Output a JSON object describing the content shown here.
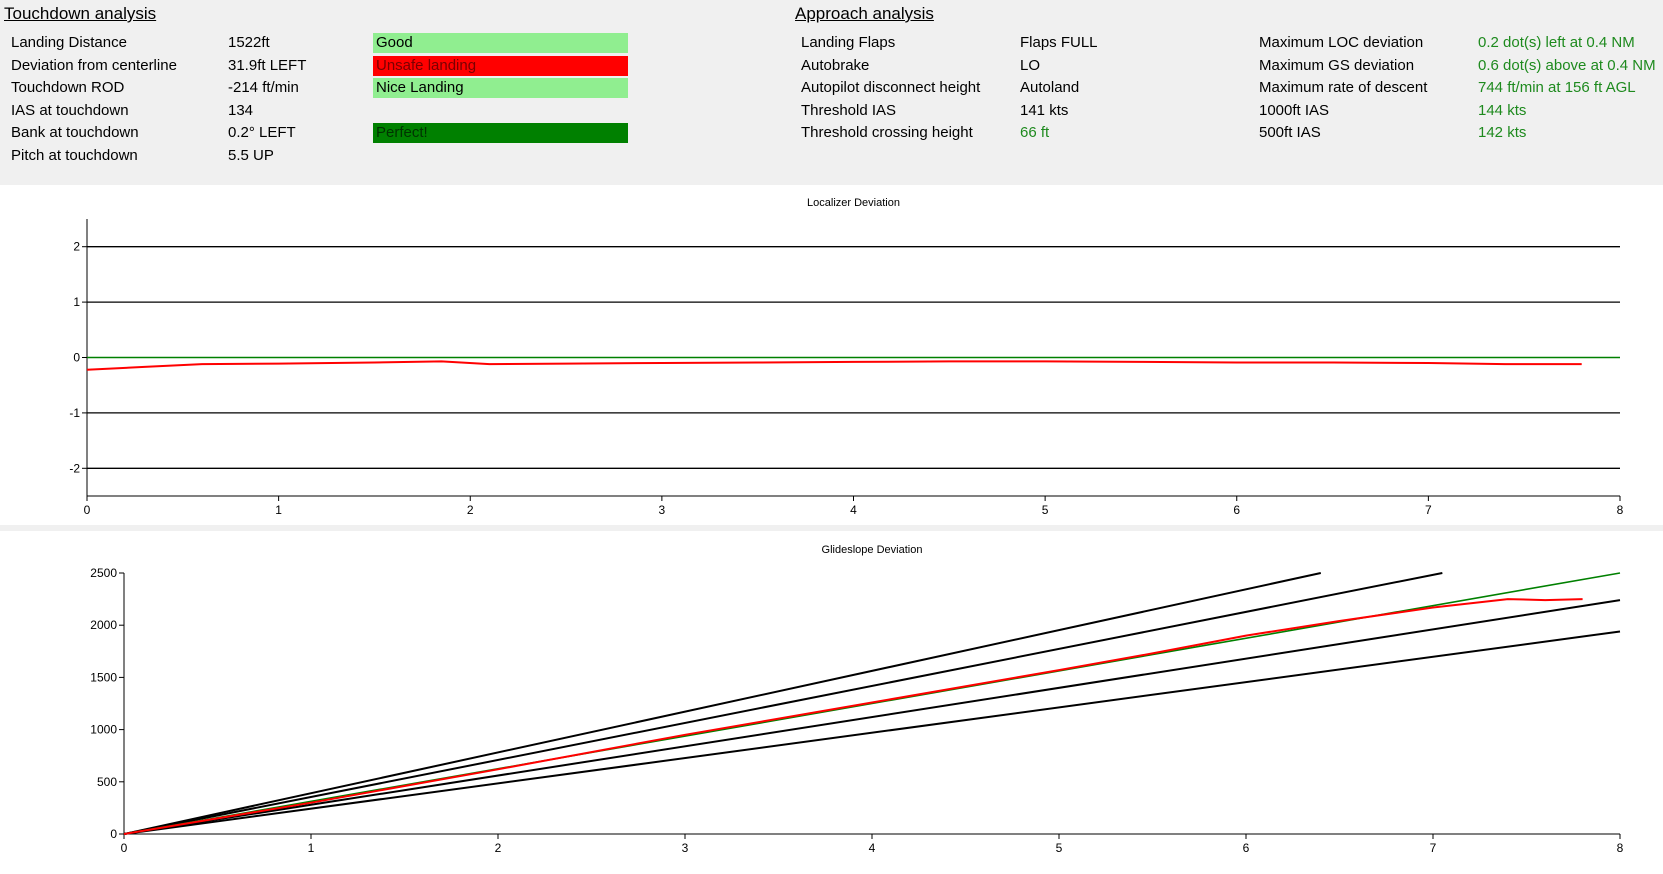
{
  "touchdown": {
    "title": "Touchdown analysis",
    "rows": [
      {
        "label": "Landing Distance",
        "value": "1522ft",
        "rating": "Good",
        "rating_color": "#90ee90",
        "rating_text_color": "#000000"
      },
      {
        "label": "Deviation from centerline",
        "value": "31.9ft LEFT",
        "rating": "Unsafe landing",
        "rating_color": "#ff0000",
        "rating_text_color": "#7a0000"
      },
      {
        "label": "Touchdown ROD",
        "value": "-214 ft/min",
        "rating": "Nice Landing",
        "rating_color": "#90ee90",
        "rating_text_color": "#000000"
      },
      {
        "label": "IAS at touchdown",
        "value": "134",
        "rating": "",
        "rating_color": "",
        "rating_text_color": ""
      },
      {
        "label": "Bank at touchdown",
        "value": "0.2° LEFT",
        "rating": "Perfect!",
        "rating_color": "#008000",
        "rating_text_color": "#003300"
      },
      {
        "label": "Pitch at touchdown",
        "value": "5.5 UP",
        "rating": "",
        "rating_color": "",
        "rating_text_color": ""
      }
    ]
  },
  "approach": {
    "title": "Approach analysis",
    "left": [
      {
        "label": "Landing Flaps",
        "value": "Flaps FULL",
        "green": false
      },
      {
        "label": "Autobrake",
        "value": "LO",
        "green": false
      },
      {
        "label": "Autopilot disconnect height",
        "value": "Autoland",
        "green": false
      },
      {
        "label": "Threshold IAS",
        "value": "141 kts",
        "green": false
      },
      {
        "label": "Threshold crossing height",
        "value": "66 ft",
        "green": true
      }
    ],
    "right": [
      {
        "label": "Maximum LOC deviation",
        "value": "0.2 dot(s) left at 0.4 NM",
        "green": true
      },
      {
        "label": "Maximum GS deviation",
        "value": "0.6 dot(s) above at 0.4 NM",
        "green": true
      },
      {
        "label": "Maximum rate of descent",
        "value": "744 ft/min at 156 ft AGL",
        "green": true
      },
      {
        "label": "1000ft IAS",
        "value": "144 kts",
        "green": true
      },
      {
        "label": "500ft IAS",
        "value": "142 kts",
        "green": true
      }
    ]
  },
  "colors": {
    "reference": "#008000",
    "actual": "#ff0000",
    "grid": "#000000"
  },
  "chart_data": [
    {
      "type": "line",
      "title": "Localizer Deviation",
      "xlabel": "",
      "ylabel": "",
      "xlim": [
        0,
        8
      ],
      "ylim": [
        -2.5,
        2.5
      ],
      "xticks": [
        0,
        1,
        2,
        3,
        4,
        5,
        6,
        7,
        8
      ],
      "yticks": [
        2,
        1,
        0,
        -1,
        -2
      ],
      "grid": true,
      "reference_lines": [
        {
          "y": 2,
          "color": "#000000"
        },
        {
          "y": 1,
          "color": "#000000"
        },
        {
          "y": -1,
          "color": "#000000"
        },
        {
          "y": -2,
          "color": "#000000"
        }
      ],
      "series": [
        {
          "color": "#008000",
          "x": [
            0,
            8
          ],
          "y": [
            0,
            0
          ]
        },
        {
          "color": "#ff0000",
          "x": [
            0,
            0.3,
            0.6,
            1.0,
            1.5,
            1.85,
            2.1,
            2.5,
            3,
            3.5,
            4,
            4.5,
            5,
            5.5,
            6,
            6.5,
            7,
            7.4,
            7.8
          ],
          "y": [
            -0.22,
            -0.17,
            -0.12,
            -0.11,
            -0.09,
            -0.07,
            -0.12,
            -0.11,
            -0.1,
            -0.09,
            -0.08,
            -0.07,
            -0.07,
            -0.08,
            -0.09,
            -0.09,
            -0.1,
            -0.12,
            -0.12
          ]
        }
      ]
    },
    {
      "type": "line",
      "title": "Glideslope Deviation",
      "xlabel": "",
      "ylabel": "",
      "xlim": [
        0,
        8
      ],
      "ylim": [
        0,
        2500
      ],
      "xticks": [
        0,
        1,
        2,
        3,
        4,
        5,
        6,
        7,
        8
      ],
      "yticks": [
        2500,
        2000,
        1500,
        1000,
        500,
        0
      ],
      "grid": false,
      "reference_lines": [
        {
          "x": [
            0,
            6.4
          ],
          "y": [
            0,
            2500
          ],
          "color": "#000000"
        },
        {
          "x": [
            0,
            7.05
          ],
          "y": [
            0,
            2500
          ],
          "color": "#000000"
        },
        {
          "x": [
            0,
            8
          ],
          "y": [
            0,
            2240
          ],
          "color": "#000000"
        },
        {
          "x": [
            0,
            8
          ],
          "y": [
            0,
            1940
          ],
          "color": "#000000"
        }
      ],
      "series": [
        {
          "color": "#008000",
          "x": [
            0,
            8
          ],
          "y": [
            0,
            2500
          ]
        },
        {
          "color": "#ff0000",
          "x": [
            0,
            1,
            2,
            3,
            4,
            5,
            5.5,
            6,
            6.5,
            7,
            7.4,
            7.6,
            7.8
          ],
          "y": [
            0,
            300,
            620,
            950,
            1260,
            1570,
            1730,
            1900,
            2040,
            2170,
            2250,
            2240,
            2250
          ]
        }
      ]
    }
  ]
}
